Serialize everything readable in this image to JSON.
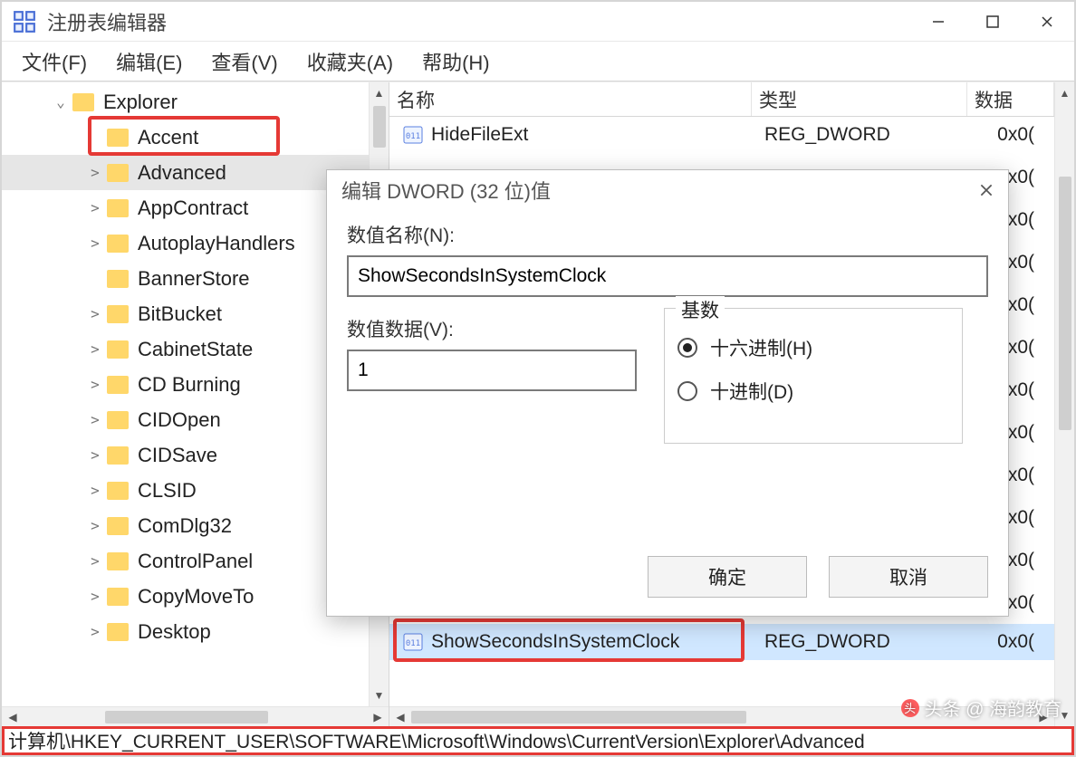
{
  "app": {
    "title": "注册表编辑器"
  },
  "menus": {
    "file": "文件(F)",
    "edit": "编辑(E)",
    "view": "查看(V)",
    "favorites": "收藏夹(A)",
    "help": "帮助(H)"
  },
  "tree": {
    "root": "Explorer",
    "items": [
      "Accent",
      "Advanced",
      "AppContract",
      "AutoplayHandlers",
      "BannerStore",
      "BitBucket",
      "CabinetState",
      "CD Burning",
      "CIDOpen",
      "CIDSave",
      "CLSID",
      "ComDlg32",
      "ControlPanel",
      "CopyMoveTo",
      "Desktop"
    ],
    "selected_index": 1,
    "expandable": [
      false,
      true,
      true,
      true,
      false,
      true,
      true,
      true,
      true,
      true,
      true,
      true,
      true,
      true,
      true
    ]
  },
  "columns": {
    "name": "名称",
    "type": "类型",
    "data": "数据"
  },
  "values": {
    "row0": {
      "name": "HideFileExt",
      "type": "REG_DWORD",
      "data": "0x0("
    },
    "selected": {
      "name": "ShowSecondsInSystemClock",
      "type": "REG_DWORD",
      "data": "0x0("
    },
    "truncated_data": [
      "0x0(",
      "0x0(",
      "0x0(",
      "0x0(",
      "0x0(",
      "0x0(",
      "0x0(",
      "0x0(",
      "0x0(",
      "0x0(",
      "0x0("
    ]
  },
  "dialog": {
    "title": "编辑 DWORD (32 位)值",
    "name_label": "数值名称(N):",
    "name_value": "ShowSecondsInSystemClock",
    "data_label": "数值数据(V):",
    "data_value": "1",
    "base_label": "基数",
    "radio_hex": "十六进制(H)",
    "radio_dec": "十进制(D)",
    "ok": "确定",
    "cancel": "取消"
  },
  "statusbar": "计算机\\HKEY_CURRENT_USER\\SOFTWARE\\Microsoft\\Windows\\CurrentVersion\\Explorer\\Advanced",
  "watermark": "头条 @ 海韵教育"
}
